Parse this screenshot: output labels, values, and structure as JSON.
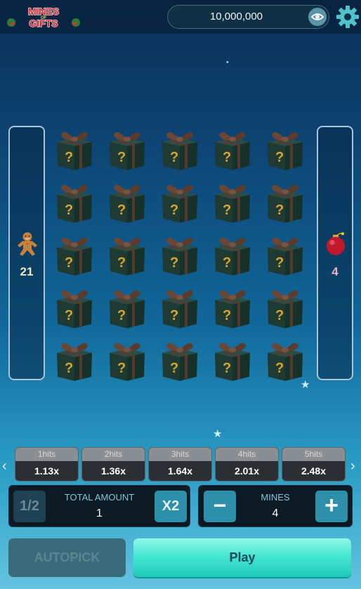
{
  "header": {
    "logo_text_top": "MINES",
    "logo_text_mid": "OF",
    "logo_text_bottom": "GIFTS",
    "balance": "10,000,000",
    "eye_icon": "eye-icon",
    "settings_icon": "gear-icon"
  },
  "side_left": {
    "icon": "gingerbread-man-icon",
    "count": "21"
  },
  "side_right": {
    "icon": "christmas-ornament-bomb-icon",
    "count": "4"
  },
  "grid": {
    "rows": 5,
    "cols": 5,
    "tile_icon": "mystery-gift-box-icon",
    "tile_mark": "?"
  },
  "multipliers": [
    {
      "hits": "1hits",
      "value": "1.13x"
    },
    {
      "hits": "2hits",
      "value": "1.36x"
    },
    {
      "hits": "3hits",
      "value": "1.64x"
    },
    {
      "hits": "4hits",
      "value": "2.01x"
    },
    {
      "hits": "5hits",
      "value": "2.48x"
    }
  ],
  "nav": {
    "prev": "‹",
    "next": "›"
  },
  "amount": {
    "half_label": "1/2",
    "label": "TOTAL AMOUNT",
    "value": "1",
    "double_label": "X2"
  },
  "mines": {
    "minus_label": "−",
    "label": "MINES",
    "value": "4",
    "plus_label": "+"
  },
  "actions": {
    "autopick": "AUTOPICK",
    "play": "Play"
  },
  "colors": {
    "gift_box": "#1e3a33",
    "gift_ribbon": "#5a3b2c",
    "question_mark": "#d9a52c",
    "play_accent": "#47e7d4"
  }
}
